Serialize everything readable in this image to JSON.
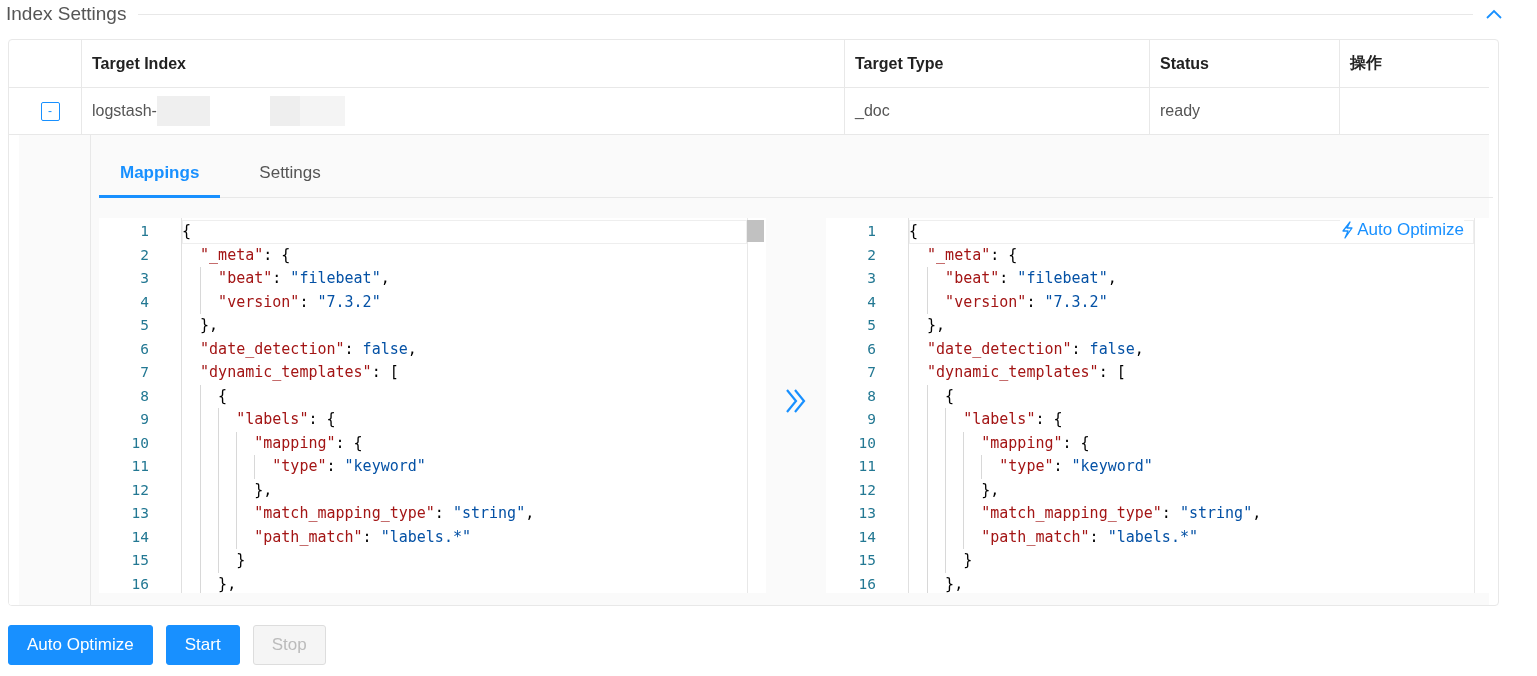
{
  "section": {
    "title": "Index Settings",
    "collapsed": false
  },
  "table": {
    "columns": [
      "Target Index",
      "Target Type",
      "Status",
      "操作"
    ],
    "rows": [
      {
        "toggle": "-",
        "expanded": true,
        "target_index": "logstash-",
        "target_type": "_doc",
        "status": "ready"
      }
    ]
  },
  "detail": {
    "tabs": [
      {
        "label": "Mappings",
        "selected": true
      },
      {
        "label": "Settings",
        "selected": false
      }
    ],
    "editors": [
      {
        "kind": "source",
        "lines": [
          {
            "no": "1",
            "tokens": [
              {
                "kind": "punct",
                "text": "{"
              }
            ]
          },
          {
            "no": "2",
            "tokens": [
              {
                "kind": "key",
                "text": "  \"_meta\""
              },
              {
                "kind": "punct",
                "text": ": {"
              }
            ]
          },
          {
            "no": "3",
            "tokens": [
              {
                "kind": "key",
                "text": "    \"beat\""
              },
              {
                "kind": "punct",
                "text": ": "
              },
              {
                "kind": "string",
                "text": "\"filebeat\""
              },
              {
                "kind": "punct",
                "text": ","
              }
            ]
          },
          {
            "no": "4",
            "tokens": [
              {
                "kind": "key",
                "text": "    \"version\""
              },
              {
                "kind": "punct",
                "text": ": "
              },
              {
                "kind": "string",
                "text": "\"7.3.2\""
              }
            ]
          },
          {
            "no": "5",
            "tokens": [
              {
                "kind": "punct",
                "text": "  },"
              }
            ]
          },
          {
            "no": "6",
            "tokens": [
              {
                "kind": "key",
                "text": "  \"date_detection\""
              },
              {
                "kind": "punct",
                "text": ": "
              },
              {
                "kind": "literal",
                "text": "false"
              },
              {
                "kind": "punct",
                "text": ","
              }
            ]
          },
          {
            "no": "7",
            "tokens": [
              {
                "kind": "key",
                "text": "  \"dynamic_templates\""
              },
              {
                "kind": "punct",
                "text": ": ["
              }
            ]
          },
          {
            "no": "8",
            "tokens": [
              {
                "kind": "punct",
                "text": "    {"
              }
            ]
          },
          {
            "no": "9",
            "tokens": [
              {
                "kind": "key",
                "text": "      \"labels\""
              },
              {
                "kind": "punct",
                "text": ": {"
              }
            ]
          },
          {
            "no": "10",
            "tokens": [
              {
                "kind": "key",
                "text": "        \"mapping\""
              },
              {
                "kind": "punct",
                "text": ": {"
              }
            ]
          },
          {
            "no": "11",
            "tokens": [
              {
                "kind": "key",
                "text": "          \"type\""
              },
              {
                "kind": "punct",
                "text": ": "
              },
              {
                "kind": "string",
                "text": "\"keyword\""
              }
            ]
          },
          {
            "no": "12",
            "tokens": [
              {
                "kind": "punct",
                "text": "        },"
              }
            ]
          },
          {
            "no": "13",
            "tokens": [
              {
                "kind": "key",
                "text": "        \"match_mapping_type\""
              },
              {
                "kind": "punct",
                "text": ": "
              },
              {
                "kind": "string",
                "text": "\"string\""
              },
              {
                "kind": "punct",
                "text": ","
              }
            ]
          },
          {
            "no": "14",
            "tokens": [
              {
                "kind": "key",
                "text": "        \"path_match\""
              },
              {
                "kind": "punct",
                "text": ": "
              },
              {
                "kind": "string",
                "text": "\"labels.*\""
              }
            ]
          },
          {
            "no": "15",
            "tokens": [
              {
                "kind": "punct",
                "text": "      }"
              }
            ]
          },
          {
            "no": "16",
            "tokens": [
              {
                "kind": "punct",
                "text": "    },"
              }
            ]
          }
        ]
      },
      {
        "kind": "result",
        "action": "Auto Optimize",
        "lines": [
          {
            "no": "1",
            "tokens": [
              {
                "kind": "punct",
                "text": "{"
              }
            ]
          },
          {
            "no": "2",
            "tokens": [
              {
                "kind": "key",
                "text": "  \"_meta\""
              },
              {
                "kind": "punct",
                "text": ": {"
              }
            ]
          },
          {
            "no": "3",
            "tokens": [
              {
                "kind": "key",
                "text": "    \"beat\""
              },
              {
                "kind": "punct",
                "text": ": "
              },
              {
                "kind": "string",
                "text": "\"filebeat\""
              },
              {
                "kind": "punct",
                "text": ","
              }
            ]
          },
          {
            "no": "4",
            "tokens": [
              {
                "kind": "key",
                "text": "    \"version\""
              },
              {
                "kind": "punct",
                "text": ": "
              },
              {
                "kind": "string",
                "text": "\"7.3.2\""
              }
            ]
          },
          {
            "no": "5",
            "tokens": [
              {
                "kind": "punct",
                "text": "  },"
              }
            ]
          },
          {
            "no": "6",
            "tokens": [
              {
                "kind": "key",
                "text": "  \"date_detection\""
              },
              {
                "kind": "punct",
                "text": ": "
              },
              {
                "kind": "literal",
                "text": "false"
              },
              {
                "kind": "punct",
                "text": ","
              }
            ]
          },
          {
            "no": "7",
            "tokens": [
              {
                "kind": "key",
                "text": "  \"dynamic_templates\""
              },
              {
                "kind": "punct",
                "text": ": ["
              }
            ]
          },
          {
            "no": "8",
            "tokens": [
              {
                "kind": "punct",
                "text": "    {"
              }
            ]
          },
          {
            "no": "9",
            "tokens": [
              {
                "kind": "key",
                "text": "      \"labels\""
              },
              {
                "kind": "punct",
                "text": ": {"
              }
            ]
          },
          {
            "no": "10",
            "tokens": [
              {
                "kind": "key",
                "text": "        \"mapping\""
              },
              {
                "kind": "punct",
                "text": ": {"
              }
            ]
          },
          {
            "no": "11",
            "tokens": [
              {
                "kind": "key",
                "text": "          \"type\""
              },
              {
                "kind": "punct",
                "text": ": "
              },
              {
                "kind": "string",
                "text": "\"keyword\""
              }
            ]
          },
          {
            "no": "12",
            "tokens": [
              {
                "kind": "punct",
                "text": "        },"
              }
            ]
          },
          {
            "no": "13",
            "tokens": [
              {
                "kind": "key",
                "text": "        \"match_mapping_type\""
              },
              {
                "kind": "punct",
                "text": ": "
              },
              {
                "kind": "string",
                "text": "\"string\""
              },
              {
                "kind": "punct",
                "text": ","
              }
            ]
          },
          {
            "no": "14",
            "tokens": [
              {
                "kind": "key",
                "text": "        \"path_match\""
              },
              {
                "kind": "punct",
                "text": ": "
              },
              {
                "kind": "string",
                "text": "\"labels.*\""
              }
            ]
          },
          {
            "no": "15",
            "tokens": [
              {
                "kind": "punct",
                "text": "      }"
              }
            ]
          },
          {
            "no": "16",
            "tokens": [
              {
                "kind": "punct",
                "text": "    },"
              }
            ]
          }
        ]
      }
    ]
  },
  "buttons": [
    {
      "label": "Auto Optimize",
      "disabled": false
    },
    {
      "label": "Start",
      "disabled": false
    },
    {
      "label": "Stop",
      "disabled": true
    }
  ]
}
